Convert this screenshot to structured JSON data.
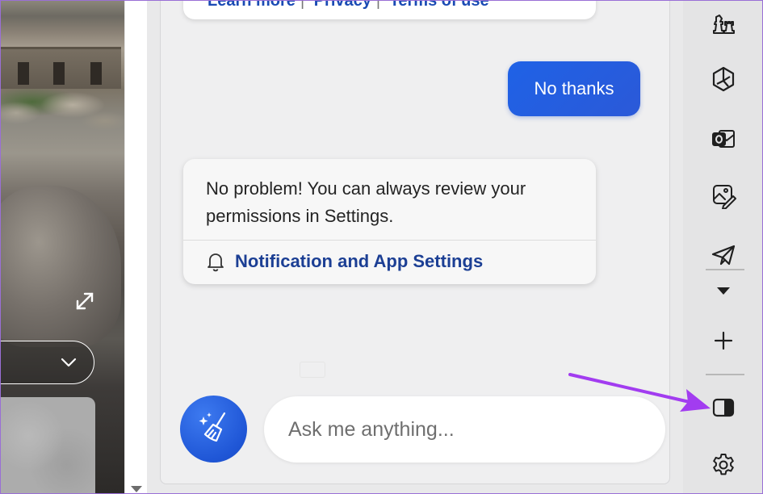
{
  "background_page": {
    "dropdown_icon": "chevron-down-icon",
    "expand_icon": "expand-arrows-icon"
  },
  "copilot": {
    "previous_card_links": [
      "Learn more",
      "Privacy",
      "Terms of use"
    ],
    "user_message": "No thanks",
    "bot_message": "No problem! You can always review your permissions in Settings.",
    "bot_link": "Notification and App Settings",
    "input_placeholder": "Ask me anything...",
    "new_topic_icon": "broom-sparkle-icon"
  },
  "rail": {
    "icons": [
      "chess-icon",
      "bing-icon",
      "outlook-icon",
      "image-creator-icon",
      "send-icon",
      "caret-down-icon",
      "plus-icon",
      "split-panel-icon",
      "gear-icon"
    ]
  },
  "colors": {
    "accent_blue": "#1f62e6",
    "link_blue": "#1c3f94",
    "annotation_arrow": "#a23cf0"
  }
}
